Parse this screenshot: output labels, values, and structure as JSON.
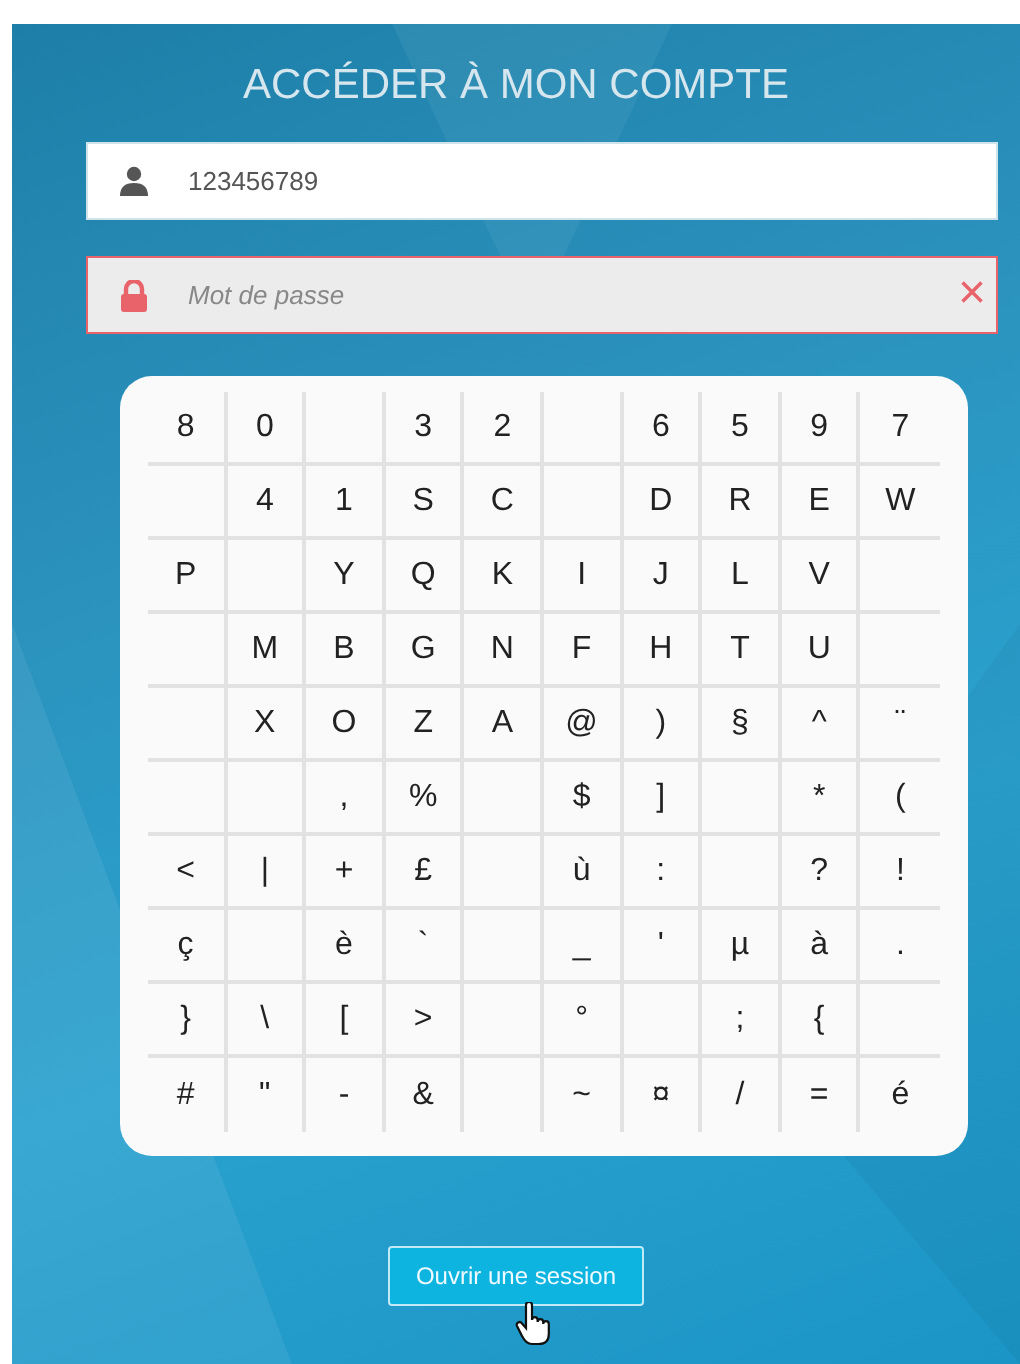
{
  "title": "ACCÉDER À MON COMPTE",
  "username": {
    "value": "123456789"
  },
  "password": {
    "placeholder": "Mot de passe",
    "invalid": true,
    "clear": "×"
  },
  "keypad": [
    [
      {
        "kind": "key",
        "label": "8"
      },
      {
        "kind": "key",
        "label": "0"
      },
      {
        "kind": "blank"
      },
      {
        "kind": "key",
        "label": "3"
      },
      {
        "kind": "key",
        "label": "2"
      },
      {
        "kind": "blank"
      },
      {
        "kind": "key",
        "label": "6"
      },
      {
        "kind": "key",
        "label": "5"
      },
      {
        "kind": "key",
        "label": "9"
      },
      {
        "kind": "key",
        "label": "7"
      }
    ],
    [
      {
        "kind": "blank"
      },
      {
        "kind": "key",
        "label": "4"
      },
      {
        "kind": "key",
        "label": "1"
      },
      {
        "kind": "key",
        "label": "S"
      },
      {
        "kind": "key",
        "label": "C"
      },
      {
        "kind": "blank"
      },
      {
        "kind": "key",
        "label": "D"
      },
      {
        "kind": "key",
        "label": "R"
      },
      {
        "kind": "key",
        "label": "E"
      },
      {
        "kind": "key",
        "label": "W"
      }
    ],
    [
      {
        "kind": "key",
        "label": "P"
      },
      {
        "kind": "blank"
      },
      {
        "kind": "key",
        "label": "Y"
      },
      {
        "kind": "key",
        "label": "Q"
      },
      {
        "kind": "key",
        "label": "K"
      },
      {
        "kind": "key",
        "label": "I"
      },
      {
        "kind": "key",
        "label": "J"
      },
      {
        "kind": "key",
        "label": "L"
      },
      {
        "kind": "key",
        "label": "V"
      },
      {
        "kind": "blank"
      }
    ],
    [
      {
        "kind": "blank"
      },
      {
        "kind": "key",
        "label": "M"
      },
      {
        "kind": "key",
        "label": "B"
      },
      {
        "kind": "key",
        "label": "G"
      },
      {
        "kind": "key",
        "label": "N"
      },
      {
        "kind": "key",
        "label": "F"
      },
      {
        "kind": "key",
        "label": "H"
      },
      {
        "kind": "key",
        "label": "T"
      },
      {
        "kind": "key",
        "label": "U"
      },
      {
        "kind": "blank"
      }
    ],
    [
      {
        "kind": "blank"
      },
      {
        "kind": "key",
        "label": "X"
      },
      {
        "kind": "key",
        "label": "O"
      },
      {
        "kind": "key",
        "label": "Z"
      },
      {
        "kind": "key",
        "label": "A"
      },
      {
        "kind": "key",
        "label": "@"
      },
      {
        "kind": "key",
        "label": ")"
      },
      {
        "kind": "key",
        "label": "§"
      },
      {
        "kind": "key",
        "label": "^"
      },
      {
        "kind": "key",
        "label": "¨"
      }
    ],
    [
      {
        "kind": "blank"
      },
      {
        "kind": "blank"
      },
      {
        "kind": "key",
        "label": ","
      },
      {
        "kind": "key",
        "label": "%"
      },
      {
        "kind": "blank"
      },
      {
        "kind": "key",
        "label": "$"
      },
      {
        "kind": "key",
        "label": "]"
      },
      {
        "kind": "blank"
      },
      {
        "kind": "key",
        "label": "*"
      },
      {
        "kind": "key",
        "label": "("
      }
    ],
    [
      {
        "kind": "key",
        "label": "<"
      },
      {
        "kind": "key",
        "label": "|"
      },
      {
        "kind": "key",
        "label": "+"
      },
      {
        "kind": "key",
        "label": "£"
      },
      {
        "kind": "blank"
      },
      {
        "kind": "key",
        "label": "ù"
      },
      {
        "kind": "key",
        "label": ":"
      },
      {
        "kind": "blank"
      },
      {
        "kind": "key",
        "label": "?"
      },
      {
        "kind": "key",
        "label": "!"
      }
    ],
    [
      {
        "kind": "key",
        "label": "ç"
      },
      {
        "kind": "blank"
      },
      {
        "kind": "key",
        "label": "è"
      },
      {
        "kind": "key",
        "label": "`"
      },
      {
        "kind": "blank"
      },
      {
        "kind": "key",
        "label": "_"
      },
      {
        "kind": "key",
        "label": "'"
      },
      {
        "kind": "key",
        "label": "µ"
      },
      {
        "kind": "key",
        "label": "à"
      },
      {
        "kind": "key",
        "label": "."
      }
    ],
    [
      {
        "kind": "key",
        "label": "}"
      },
      {
        "kind": "key",
        "label": "\\"
      },
      {
        "kind": "key",
        "label": "["
      },
      {
        "kind": "key",
        "label": ">"
      },
      {
        "kind": "blank"
      },
      {
        "kind": "key",
        "label": "°"
      },
      {
        "kind": "blank"
      },
      {
        "kind": "key",
        "label": ";"
      },
      {
        "kind": "key",
        "label": "{"
      },
      {
        "kind": "blank"
      }
    ],
    [
      {
        "kind": "key",
        "label": "#"
      },
      {
        "kind": "key",
        "label": "\""
      },
      {
        "kind": "key",
        "label": "-"
      },
      {
        "kind": "key",
        "label": "&"
      },
      {
        "kind": "blank"
      },
      {
        "kind": "key",
        "label": "~"
      },
      {
        "kind": "key",
        "label": "¤"
      },
      {
        "kind": "key",
        "label": "/"
      },
      {
        "kind": "key",
        "label": "="
      },
      {
        "kind": "key",
        "label": "é"
      }
    ]
  ],
  "submit": {
    "label": "Ouvrir une session"
  }
}
